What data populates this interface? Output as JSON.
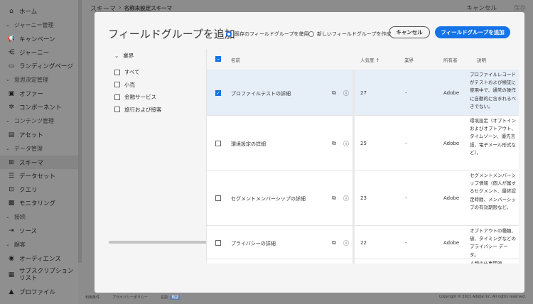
{
  "sidebar": {
    "items": [
      {
        "type": "item",
        "label": "ホーム",
        "icon": "home-icon",
        "glyph": "⌂"
      },
      {
        "type": "section",
        "label": "ジャーニー管理"
      },
      {
        "type": "item",
        "label": "キャンペーン",
        "icon": "megaphone-icon",
        "glyph": "📢"
      },
      {
        "type": "item",
        "label": "ジャーニー",
        "icon": "journey-icon",
        "glyph": "⋲"
      },
      {
        "type": "item",
        "label": "ランディングページ",
        "icon": "landing-page-icon",
        "glyph": "▭"
      },
      {
        "type": "section",
        "label": "意思決定管理"
      },
      {
        "type": "item",
        "label": "オファー",
        "icon": "offer-icon",
        "glyph": "▣"
      },
      {
        "type": "item",
        "label": "コンポーネント",
        "icon": "component-icon",
        "glyph": "✲"
      },
      {
        "type": "section",
        "label": "コンテンツ管理"
      },
      {
        "type": "item",
        "label": "アセット",
        "icon": "asset-icon",
        "glyph": "▤"
      },
      {
        "type": "section",
        "label": "データ管理"
      },
      {
        "type": "item",
        "label": "スキーマ",
        "icon": "schema-icon",
        "glyph": "⊞",
        "active": true
      },
      {
        "type": "item",
        "label": "データセット",
        "icon": "dataset-icon",
        "glyph": "☰"
      },
      {
        "type": "item",
        "label": "クエリ",
        "icon": "query-icon",
        "glyph": "⊡"
      },
      {
        "type": "item",
        "label": "モニタリング",
        "icon": "monitoring-icon",
        "glyph": "▩"
      },
      {
        "type": "section",
        "label": "接続"
      },
      {
        "type": "item",
        "label": "ソース",
        "icon": "source-icon",
        "glyph": "⇥"
      },
      {
        "type": "section",
        "label": "顧客"
      },
      {
        "type": "item",
        "label": "オーディエンス",
        "icon": "audience-icon",
        "glyph": "◉"
      },
      {
        "type": "item",
        "label": "サブスクリプションリスト",
        "icon": "subscription-icon",
        "glyph": "▦"
      },
      {
        "type": "item",
        "label": "プロファイル",
        "icon": "profile-icon",
        "glyph": "▲"
      }
    ]
  },
  "topbar": {
    "breadcrumb_root": "スキーマ",
    "breadcrumb_current": "名称未設定スキーマ",
    "cancel": "キャンセル",
    "save": "保存"
  },
  "footer": {
    "terms": "利用条件",
    "privacy": "プライバシーポリシー",
    "language_label": "言語:",
    "language": "英語",
    "copyright": "Copyright © 2021 Adobe Inc. All rights reserved."
  },
  "modal": {
    "title": "フィールドグループを追加",
    "radio_existing": "既存のフィールドグループを使用",
    "radio_new": "新しいフィールドグループを作成",
    "cancel": "キャンセル",
    "add": "フィールドグループを追加",
    "filter": {
      "heading": "業界",
      "options": [
        "すべて",
        "小売",
        "金融サービス",
        "旅行および接客"
      ]
    },
    "columns": {
      "name": "名前",
      "popularity": "人気度",
      "industry": "業界",
      "owner": "所有者",
      "description": "説明"
    },
    "rows": [
      {
        "name": "プロファイルテストの詳細",
        "popularity": "27",
        "industry": "-",
        "owner": "Adobe",
        "description": "プロファイルレコードがテストおよび検証に使用中で、通常の操作に自動的に含まれるべきでない。",
        "selected": true
      },
      {
        "name": "環境設定の詳細",
        "popularity": "25",
        "industry": "-",
        "owner": "Adobe",
        "description": "環境設定（オプトインおよびオプトアウト、タイムゾーン、優先言語、電子メール形式など）。",
        "selected": false
      },
      {
        "name": "セグメントメンバーシップの詳細",
        "popularity": "23",
        "industry": "-",
        "owner": "Adobe",
        "description": "セグメントメンバーシップ情報（個人が属するセグメント、最終認定時間、メンバーシップの有効期限など。",
        "selected": false
      },
      {
        "name": "プライバシーの詳細",
        "popularity": "22",
        "industry": "-",
        "owner": "Adobe",
        "description": "オプトアウトの種類、値、タイミングなどのプライバシー データ。",
        "selected": false
      }
    ],
    "partial_row_desc": "人物の仕事関連"
  }
}
